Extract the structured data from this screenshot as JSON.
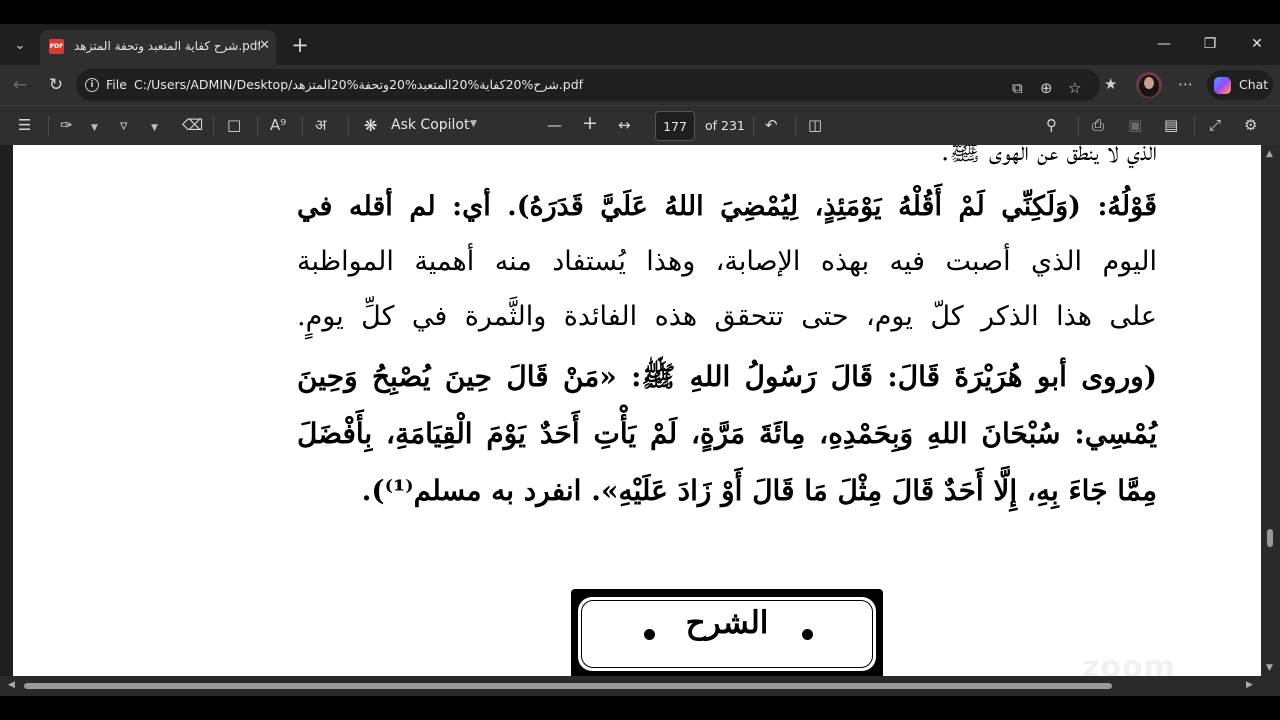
{
  "browser": {
    "tab": {
      "title": "شرح كفاية المتعبد وتحفة المتزهد.pdf",
      "icon_label": "PDF"
    },
    "address": {
      "scheme_label": "File",
      "url": "C:/Users/ADMIN/Desktop/شرح%20كفاية%20المتعبد%20وتحفة%20المتزهد.pdf"
    },
    "chat_label": "Chat"
  },
  "pdf_toolbar": {
    "ask_copilot_label": "Ask Copilot",
    "current_page": "177",
    "page_count_label": "of 231"
  },
  "document": {
    "lines": [
      "الذي لا ينطق عن الهوى ﷺ.",
      "قَوْلُهُ: (وَلَكِنِّي لَمْ أَقُلْهُ يَوْمَئِذٍ، لِيُمْضِيَ اللهُ عَلَيَّ قَدَرَهُ). أي: لم أقله في",
      "اليوم الذي أصبت فيه بهذه الإصابة، وهذا يُستفاد منه أهمية المواظبة",
      "على هذا الذكر كلّ يوم، حتى تتحقق هذه الفائدة والثَّمرة في كلِّ يومٍ.",
      "(وروى أبو هُرَيْرَةَ قَالَ: قَالَ رَسُولُ اللهِ ﷺ: «مَنْ قَالَ حِينَ يُصْبِحُ وَحِينَ",
      "يُمْسِي: سُبْحَانَ اللهِ وَبِحَمْدِهِ، مِائَةَ مَرَّةٍ، لَمْ يَأْتِ أَحَدٌ يَوْمَ الْقِيَامَةِ، بِأَفْضَلَ",
      "مِمَّا جَاءَ بِهِ، إِلَّا أَحَدٌ قَالَ مِثْلَ مَا قَالَ أَوْ زَادَ عَلَيْهِ». انفرد به مسلم⁽¹⁾)."
    ],
    "section_title": "الشرح"
  },
  "watermark": "zoom"
}
